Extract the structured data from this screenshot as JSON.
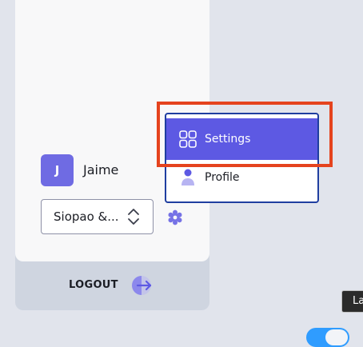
{
  "user": {
    "initial": "J",
    "name": "Jaime"
  },
  "workspace": {
    "selected": "Siopao &..."
  },
  "logout": {
    "label": "LOGOUT"
  },
  "menu": {
    "items": [
      {
        "label": "Settings",
        "icon": "grid-icon",
        "active": true
      },
      {
        "label": "Profile",
        "icon": "person-icon",
        "active": false
      }
    ]
  },
  "tooltip": {
    "text": "La"
  },
  "colors": {
    "accent": "#5d59e3",
    "avatar_bg": "#6f6be3",
    "highlight": "#e5431e",
    "dropdown_border": "#1f3ea0"
  }
}
